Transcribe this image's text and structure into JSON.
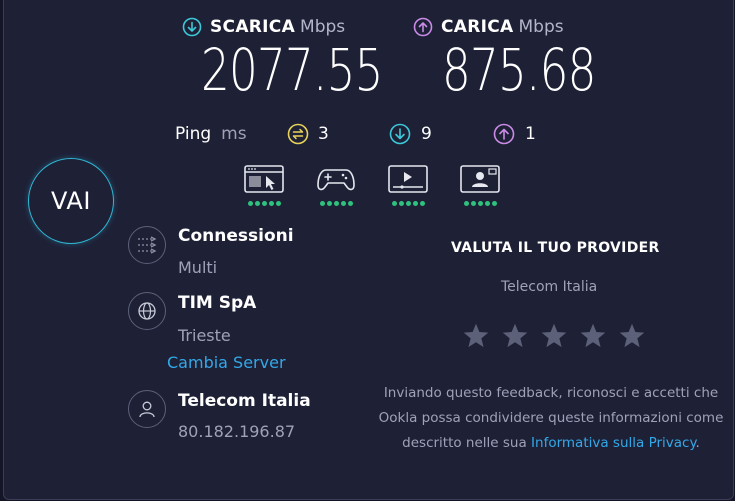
{
  "download": {
    "label": "SCARICA",
    "unit": "Mbps",
    "value": "2077.55",
    "icon": "arrow-down-circle-icon",
    "color": "#3cc9d8"
  },
  "upload": {
    "label": "CARICA",
    "unit": "Mbps",
    "value": "875.68",
    "icon": "arrow-up-circle-icon",
    "color": "#c98be6"
  },
  "ping": {
    "label": "Ping",
    "unit": "ms",
    "idle": {
      "value": "3",
      "icon": "swap-circle-icon",
      "color": "#e8d35a"
    },
    "download": {
      "value": "9",
      "icon": "arrow-down-circle-icon",
      "color": "#3cc9d8"
    },
    "upload": {
      "value": "1",
      "icon": "arrow-up-circle-icon",
      "color": "#c98be6"
    }
  },
  "go_button": {
    "label": "VAI",
    "color": "#2fb8d6"
  },
  "activity_icons": [
    {
      "icon": "web-browsing-icon",
      "rating": 5
    },
    {
      "icon": "gaming-controller-icon",
      "rating": 5
    },
    {
      "icon": "video-streaming-icon",
      "rating": 5
    },
    {
      "icon": "video-call-icon",
      "rating": 5
    }
  ],
  "connections": {
    "icon": "connections-icon",
    "title": "Connessioni",
    "value": "Multi"
  },
  "server": {
    "icon": "globe-icon",
    "title": "TIM SpA",
    "location": "Trieste",
    "change_label": "Cambia Server"
  },
  "isp": {
    "icon": "user-icon",
    "title": "Telecom Italia",
    "ip": "80.182.196.87"
  },
  "rating": {
    "title": "VALUTA IL TUO PROVIDER",
    "provider": "Telecom Italia",
    "stars": 5,
    "disclaimer": "Inviando questo feedback, riconosci e accetti che Ookla possa condividere queste informazioni come descritto nelle sua",
    "privacy_link": "Informativa sulla Privacy",
    "privacy_suffix": "."
  }
}
